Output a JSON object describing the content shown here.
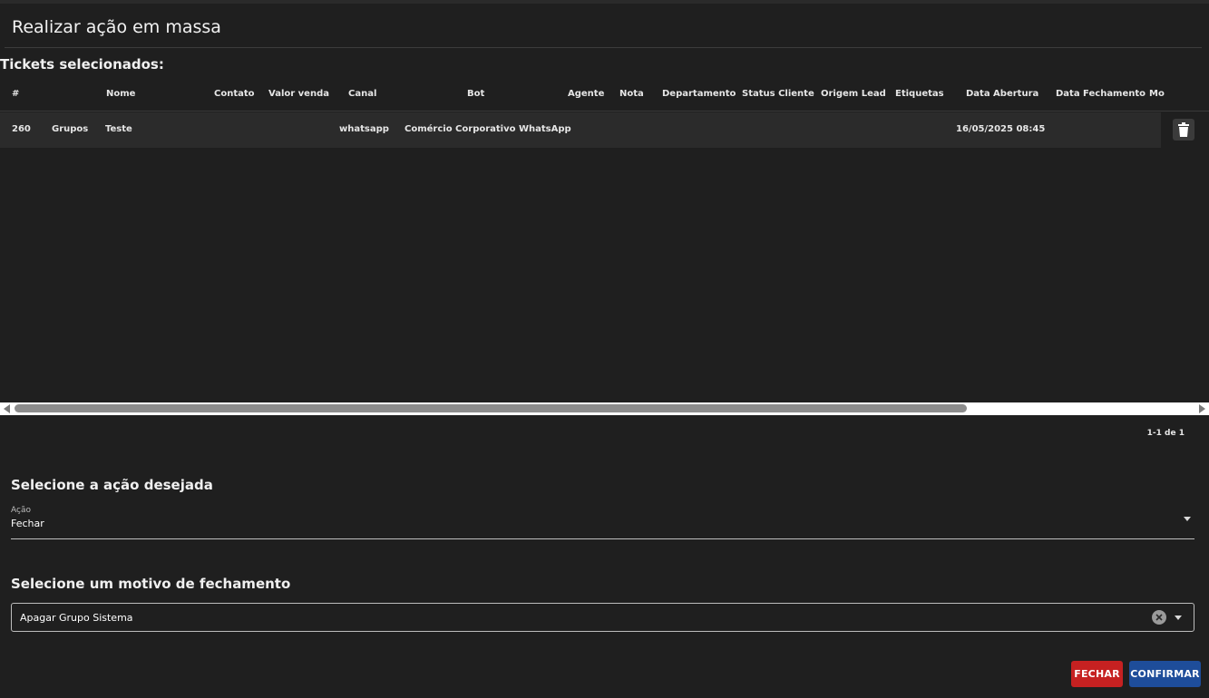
{
  "modal": {
    "title": "Realizar ação em massa"
  },
  "tickets": {
    "section_label": "Tickets selecionados:",
    "columns": [
      "#",
      "Nome",
      "Contato",
      "Valor venda",
      "Canal",
      "Bot",
      "Agente",
      "Nota",
      "Departamento",
      "Status Cliente",
      "Origem Lead",
      "Etiquetas",
      "Data Abertura",
      "Data Fechamento",
      "Mo"
    ],
    "rows": [
      {
        "id": "260",
        "group": "Grupos",
        "nome": "Teste",
        "contato": "",
        "valor_venda": "",
        "canal": "whatsapp",
        "bot": "Comércio Corporativo WhatsApp",
        "agente": "",
        "nota": "",
        "departamento": "",
        "status_cliente": "",
        "origem_lead": "",
        "etiquetas": "",
        "data_abertura": "16/05/2025 08:45",
        "data_fechamento": "",
        "delete_icon": "trash-icon"
      }
    ],
    "pagination": "1-1 de 1"
  },
  "action": {
    "heading": "Selecione a ação desejada",
    "field_label": "Ação",
    "selected": "Fechar"
  },
  "reason": {
    "heading": "Selecione um motivo de fechamento",
    "selected": "Apagar Grupo Sistema"
  },
  "buttons": {
    "fechar": "FECHAR",
    "confirmar": "CONFIRMAR"
  },
  "colors": {
    "background": "#1f1f1f",
    "row_background": "#2b2b2b",
    "fechar_button": "#c62121",
    "confirmar_button": "#1e4d9a"
  }
}
